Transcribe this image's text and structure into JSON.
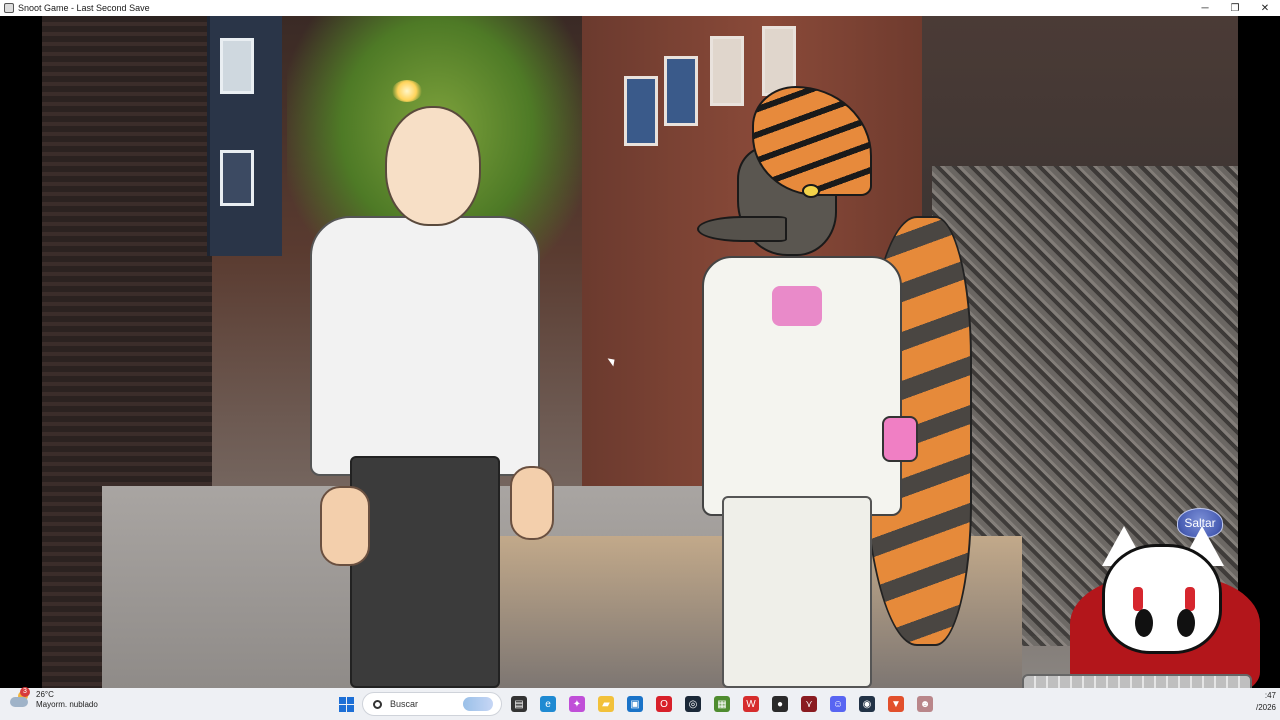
{
  "window": {
    "title": "Snoot Game - Last Second Save",
    "minimize_glyph": "─",
    "restore_glyph": "❐",
    "close_glyph": "✕"
  },
  "game": {
    "skip_button_label": "Saltar",
    "skip_extra_label": "r"
  },
  "taskbar": {
    "weather": {
      "badge": "3",
      "temperature": "26°C",
      "condition": "Mayorm. nublado"
    },
    "search": {
      "placeholder": "Buscar"
    },
    "apps": [
      {
        "name": "file-explorer-icon",
        "glyph": "▤",
        "color": "#333333"
      },
      {
        "name": "edge-icon",
        "glyph": "e",
        "color": "#1f8ad2"
      },
      {
        "name": "copilot-icon",
        "glyph": "✦",
        "color": "#c04fd8"
      },
      {
        "name": "folder-icon",
        "glyph": "▰",
        "color": "#f2c13a"
      },
      {
        "name": "store-icon",
        "glyph": "▣",
        "color": "#1a73c8"
      },
      {
        "name": "opera-icon",
        "glyph": "O",
        "color": "#d8202a"
      },
      {
        "name": "steam-icon",
        "glyph": "◎",
        "color": "#1b2838"
      },
      {
        "name": "minecraft-icon",
        "glyph": "▦",
        "color": "#4f8c2f"
      },
      {
        "name": "wps-icon",
        "glyph": "W",
        "color": "#d62d2d"
      },
      {
        "name": "app-dark-icon",
        "glyph": "●",
        "color": "#2a2a2a"
      },
      {
        "name": "app-red-icon",
        "glyph": "⋎",
        "color": "#8a1b20"
      },
      {
        "name": "discord-icon",
        "glyph": "☺",
        "color": "#5865f2"
      },
      {
        "name": "steam-alt-icon",
        "glyph": "◉",
        "color": "#223246"
      },
      {
        "name": "brave-icon",
        "glyph": "▼",
        "color": "#e2502c"
      },
      {
        "name": "game-icon",
        "glyph": "☻",
        "color": "#b9868a"
      }
    ],
    "clock": {
      "time": ":47",
      "date": "/2026"
    }
  },
  "colors": {
    "taskbar_bg": "#eef0f4",
    "skip_button": "#4a5fb5",
    "mascot_cape": "#b3161b"
  }
}
